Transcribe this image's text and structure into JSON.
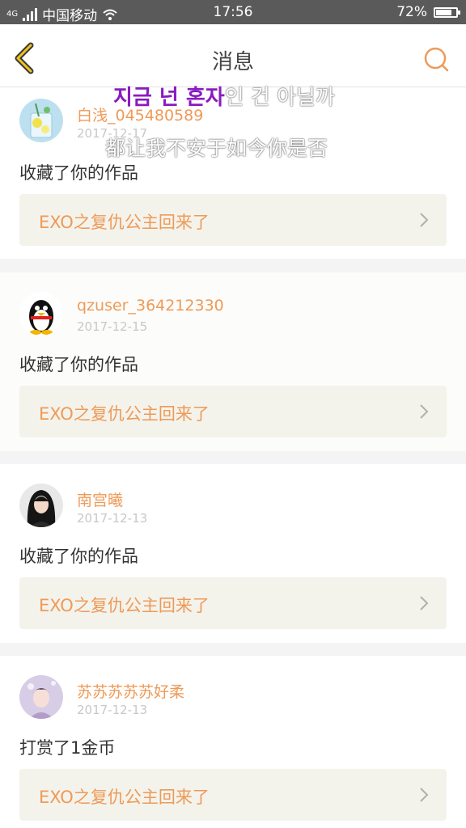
{
  "status_bar": {
    "network_badge": "4G",
    "carrier": "中国移动",
    "time": "17:56",
    "battery": "72%"
  },
  "nav": {
    "back_icon": "chevron-left-icon",
    "title": "消息",
    "search_icon": "search-icon",
    "accent_color": "#ef9a57"
  },
  "messages": [
    {
      "username": "白浅_045480589",
      "date": "2017-12-17",
      "action": "收藏了你的作品",
      "work_title": "EXO之复仇公主回来了",
      "avatar_icon": "lemonade-avatar"
    },
    {
      "username": "qzuser_364212330",
      "date": "2017-12-15",
      "action": "收藏了你的作品",
      "work_title": "EXO之复仇公主回来了",
      "avatar_icon": "qq-penguin-avatar"
    },
    {
      "username": "南宫曦",
      "date": "2017-12-13",
      "action": "收藏了你的作品",
      "work_title": "EXO之复仇公主回来了",
      "avatar_icon": "girl-portrait-avatar"
    },
    {
      "username": "苏苏苏苏苏好柔",
      "date": "2017-12-13",
      "action": "打赏了1金币",
      "work_title": "EXO之复仇公主回来了",
      "avatar_icon": "boy-portrait-avatar"
    }
  ],
  "overlay": {
    "korean_highlight": "지금 넌 혼자",
    "korean_rest": "인 건 아닐까",
    "chinese": "都让我不安于如今你是否"
  }
}
